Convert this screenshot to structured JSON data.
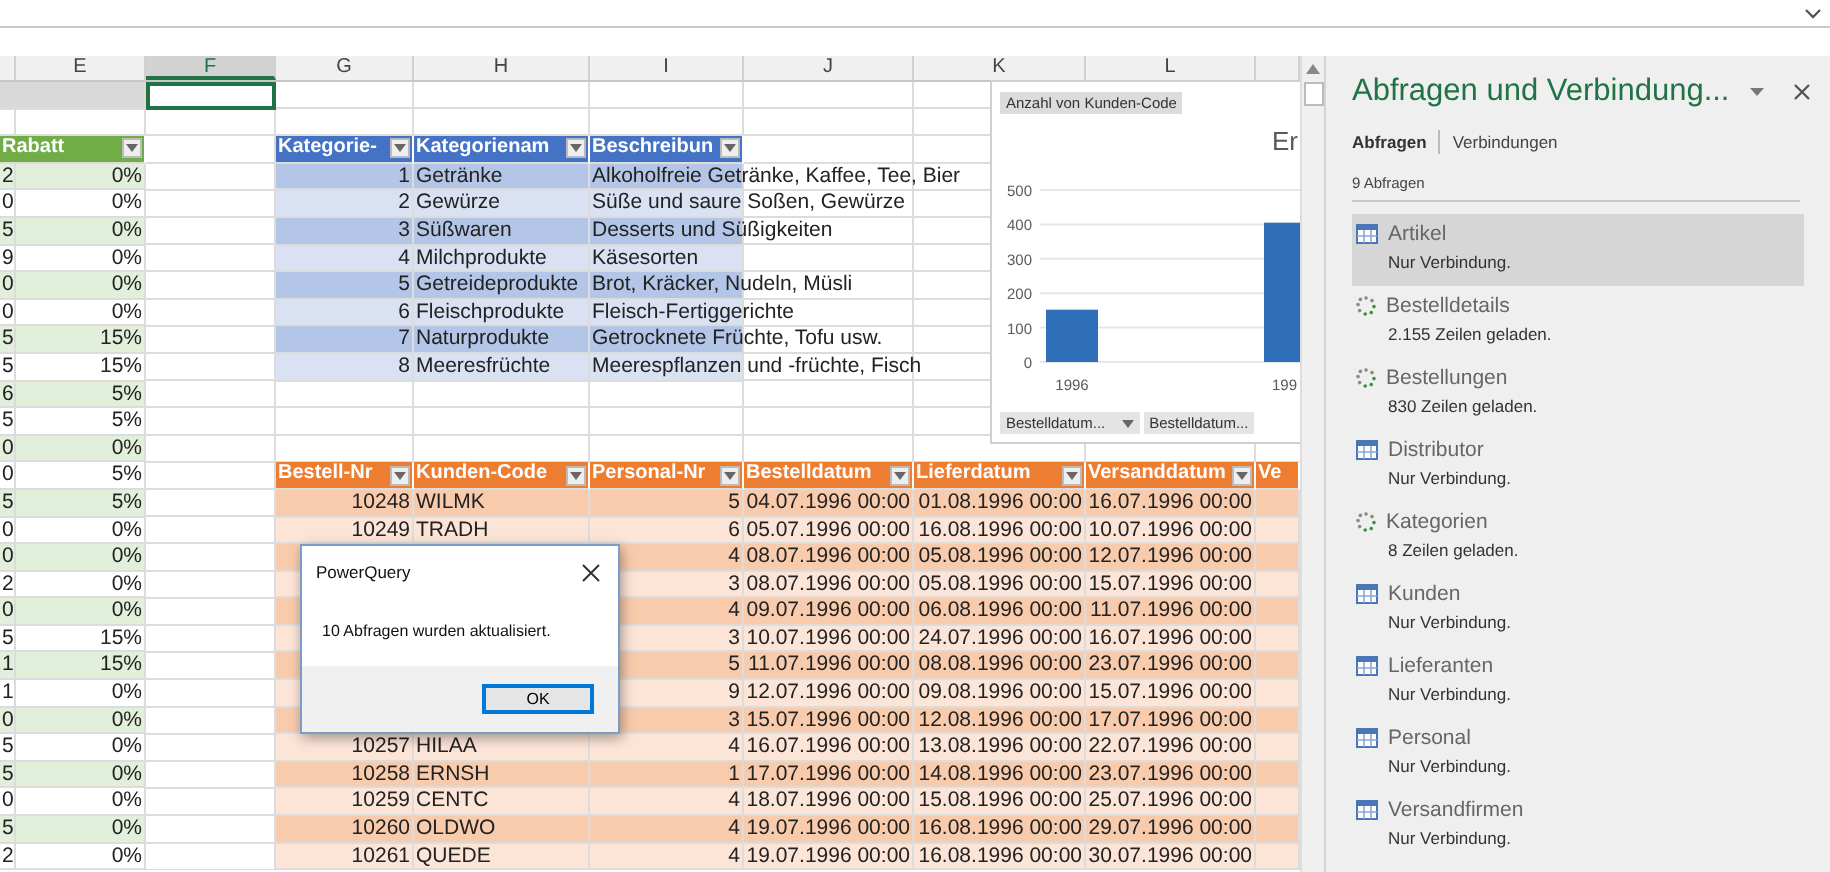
{
  "columns": [
    {
      "label": "E",
      "selected": false
    },
    {
      "label": "F",
      "selected": true
    },
    {
      "label": "G",
      "selected": false
    },
    {
      "label": "H",
      "selected": false
    },
    {
      "label": "I",
      "selected": false
    },
    {
      "label": "J",
      "selected": false
    },
    {
      "label": "K",
      "selected": false
    },
    {
      "label": "L",
      "selected": false
    }
  ],
  "discount_table": {
    "header": {
      "label": "Rabatt",
      "dropdown": true
    },
    "column_d": [
      "2",
      "0",
      "5",
      "9",
      "0",
      "0",
      "5",
      "5",
      "6",
      "5",
      "0",
      "0",
      "5",
      "0",
      "0",
      "2",
      "0",
      "5",
      "1",
      "1",
      "0",
      "5",
      "5",
      "0",
      "5",
      "2"
    ],
    "values": [
      "0%",
      "0%",
      "0%",
      "0%",
      "0%",
      "0%",
      "15%",
      "15%",
      "5%",
      "5%",
      "0%",
      "5%",
      "5%",
      "0%",
      "0%",
      "0%",
      "0%",
      "15%",
      "15%",
      "0%",
      "0%",
      "0%",
      "0%",
      "0%",
      "0%",
      "0%"
    ]
  },
  "category_table": {
    "columns": [
      {
        "label": "Kategorie-",
        "dropdown": true
      },
      {
        "label": "Kategorienam",
        "dropdown": true
      },
      {
        "label": "Beschreibun",
        "dropdown": true
      }
    ],
    "rows": [
      {
        "id": "1",
        "name": "Getränke",
        "description": "Alkoholfreie Getränke, Kaffee, Tee, Bier"
      },
      {
        "id": "2",
        "name": "Gewürze",
        "description": "Süße und saure Soßen, Gewürze"
      },
      {
        "id": "3",
        "name": "Süßwaren",
        "description": "Desserts und Süßigkeiten"
      },
      {
        "id": "4",
        "name": "Milchprodukte",
        "description": "Käsesorten"
      },
      {
        "id": "5",
        "name": "Getreideprodukte",
        "description": "Brot, Kräcker, Nudeln, Müsli"
      },
      {
        "id": "6",
        "name": "Fleischprodukte",
        "description": "Fleisch-Fertiggerichte"
      },
      {
        "id": "7",
        "name": "Naturprodukte",
        "description": "Getrocknete Früchte, Tofu usw."
      },
      {
        "id": "8",
        "name": "Meeresfrüchte",
        "description": "Meerespflanzen und -früchte, Fisch"
      }
    ]
  },
  "orders_table": {
    "columns": [
      {
        "label": "Bestell-Nr",
        "dropdown": true
      },
      {
        "label": "Kunden-Code",
        "dropdown": true
      },
      {
        "label": "Personal-Nr",
        "dropdown": true
      },
      {
        "label": "Bestelldatum",
        "dropdown": true
      },
      {
        "label": "Lieferdatum",
        "dropdown": true
      },
      {
        "label": "Versanddatum",
        "dropdown": true
      },
      {
        "label": "Ve",
        "dropdown": false
      }
    ],
    "rows": [
      {
        "bestell_nr": "10248",
        "kunden_code": "WILMK",
        "personal_nr": "5",
        "bestelldatum": "04.07.1996 00:00",
        "lieferdatum": "01.08.1996 00:00",
        "versanddatum": "16.07.1996 00:00"
      },
      {
        "bestell_nr": "10249",
        "kunden_code": "TRADH",
        "personal_nr": "6",
        "bestelldatum": "05.07.1996 00:00",
        "lieferdatum": "16.08.1996 00:00",
        "versanddatum": "10.07.1996 00:00"
      },
      {
        "personal_nr": "4",
        "bestelldatum": "08.07.1996 00:00",
        "lieferdatum": "05.08.1996 00:00",
        "versanddatum": "12.07.1996 00:00"
      },
      {
        "personal_nr": "3",
        "bestelldatum": "08.07.1996 00:00",
        "lieferdatum": "05.08.1996 00:00",
        "versanddatum": "15.07.1996 00:00"
      },
      {
        "personal_nr": "4",
        "bestelldatum": "09.07.1996 00:00",
        "lieferdatum": "06.08.1996 00:00",
        "versanddatum": "11.07.1996 00:00"
      },
      {
        "personal_nr": "3",
        "bestelldatum": "10.07.1996 00:00",
        "lieferdatum": "24.07.1996 00:00",
        "versanddatum": "16.07.1996 00:00"
      },
      {
        "personal_nr": "5",
        "bestelldatum": "11.07.1996 00:00",
        "lieferdatum": "08.08.1996 00:00",
        "versanddatum": "23.07.1996 00:00"
      },
      {
        "personal_nr": "9",
        "bestelldatum": "12.07.1996 00:00",
        "lieferdatum": "09.08.1996 00:00",
        "versanddatum": "15.07.1996 00:00"
      },
      {
        "personal_nr": "3",
        "bestelldatum": "15.07.1996 00:00",
        "lieferdatum": "12.08.1996 00:00",
        "versanddatum": "17.07.1996 00:00"
      },
      {
        "bestell_nr": "10257",
        "kunden_code": "HILAA",
        "personal_nr": "4",
        "bestelldatum": "16.07.1996 00:00",
        "lieferdatum": "13.08.1996 00:00",
        "versanddatum": "22.07.1996 00:00"
      },
      {
        "bestell_nr": "10258",
        "kunden_code": "ERNSH",
        "personal_nr": "1",
        "bestelldatum": "17.07.1996 00:00",
        "lieferdatum": "14.08.1996 00:00",
        "versanddatum": "23.07.1996 00:00"
      },
      {
        "bestell_nr": "10259",
        "kunden_code": "CENTC",
        "personal_nr": "4",
        "bestelldatum": "18.07.1996 00:00",
        "lieferdatum": "15.08.1996 00:00",
        "versanddatum": "25.07.1996 00:00"
      },
      {
        "bestell_nr": "10260",
        "kunden_code": "OLDWO",
        "personal_nr": "4",
        "bestelldatum": "19.07.1996 00:00",
        "lieferdatum": "16.08.1996 00:00",
        "versanddatum": "29.07.1996 00:00"
      },
      {
        "bestell_nr": "10261",
        "kunden_code": "QUEDE",
        "personal_nr": "4",
        "bestelldatum": "19.07.1996 00:00",
        "lieferdatum": "16.08.1996 00:00",
        "versanddatum": "30.07.1996 00:00"
      }
    ]
  },
  "chart": {
    "field_label": "Anzahl von Kunden-Code",
    "axis_buttons": [
      {
        "label": "Bestelldatum...",
        "dropdown": true
      },
      {
        "label": "Bestelldatum...",
        "dropdown": false
      }
    ],
    "chart_data": {
      "type": "bar",
      "title": "Er",
      "grid": true,
      "categories": [
        "1996",
        "199"
      ],
      "values": [
        152,
        405
      ],
      "ylim": [
        0,
        500
      ],
      "yticks": [
        0,
        100,
        200,
        300,
        400,
        500
      ]
    }
  },
  "dialog": {
    "title": "PowerQuery",
    "message": "10 Abfragen wurden aktualisiert.",
    "buttons": [
      "OK"
    ]
  },
  "panel": {
    "title": "Abfragen und Verbindung...",
    "tabs": [
      {
        "label": "Abfragen",
        "selected": true
      },
      {
        "label": "Verbindungen",
        "selected": false
      }
    ],
    "count": "9 Abfragen",
    "queries": [
      {
        "name": "Artikel",
        "status": "Nur Verbindung.",
        "kind": "table",
        "selected": true
      },
      {
        "name": "Bestelldetails",
        "status": "2.155 Zeilen geladen.",
        "kind": "loading",
        "selected": false
      },
      {
        "name": "Bestellungen",
        "status": "830 Zeilen geladen.",
        "kind": "loading",
        "selected": false
      },
      {
        "name": "Distributor",
        "status": "Nur Verbindung.",
        "kind": "table",
        "selected": false
      },
      {
        "name": "Kategorien",
        "status": "8 Zeilen geladen.",
        "kind": "loading",
        "selected": false
      },
      {
        "name": "Kunden",
        "status": "Nur Verbindung.",
        "kind": "table",
        "selected": false
      },
      {
        "name": "Lieferanten",
        "status": "Nur Verbindung.",
        "kind": "table",
        "selected": false
      },
      {
        "name": "Personal",
        "status": "Nur Verbindung.",
        "kind": "table",
        "selected": false
      },
      {
        "name": "Versandfirmen",
        "status": "Nur Verbindung.",
        "kind": "table",
        "selected": false
      }
    ]
  }
}
